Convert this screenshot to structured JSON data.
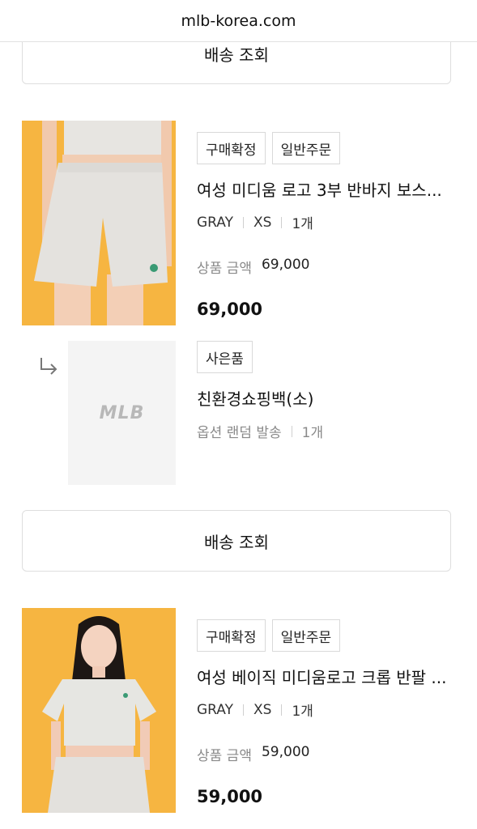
{
  "browser": {
    "url": "mlb-korea.com"
  },
  "top_button": {
    "label": "배송 조회"
  },
  "order1": {
    "badges": [
      "구매확정",
      "일반주문"
    ],
    "name": "여성 미디움 로고 3부 반바지 보스...",
    "color": "GRAY",
    "size": "XS",
    "qty": "1개",
    "price_label": "상품 금액",
    "price_value": "69,000",
    "total": "69,000"
  },
  "gift": {
    "badge": "사은품",
    "name": "친환경쇼핑백(소)",
    "option": "옵션 랜덤 발송",
    "qty": "1개",
    "logo_text": "MLB"
  },
  "middle_button": {
    "label": "배송 조회"
  },
  "order2": {
    "badges": [
      "구매확정",
      "일반주문"
    ],
    "name": "여성 베이직 미디움로고 크롭 반팔 ...",
    "color": "GRAY",
    "size": "XS",
    "qty": "1개",
    "price_label": "상품 금액",
    "price_value": "59,000",
    "total": "59,000"
  },
  "colors": {
    "thumb_bg": "#f6b541",
    "border": "#dedede",
    "muted": "#8a8a8a"
  }
}
